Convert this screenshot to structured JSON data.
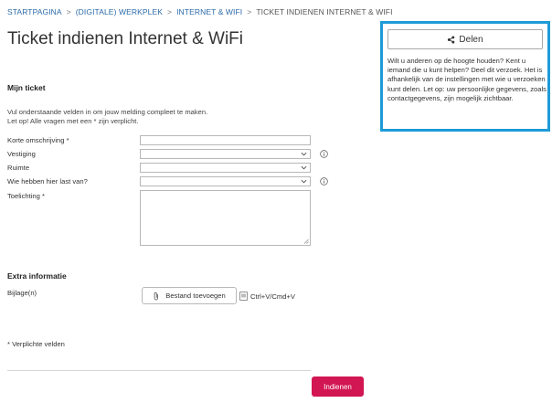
{
  "breadcrumb": {
    "items": [
      "STARTPAGINA",
      "(DIGITALE) WERKPLEK",
      "INTERNET & WIFI"
    ],
    "current": "TICKET INDIENEN INTERNET & WIFI",
    "separator": ">"
  },
  "page_title": "Ticket indienen Internet & WiFi",
  "my_ticket": {
    "heading": "Mijn ticket",
    "intro_line1": "Vul onderstaande velden in om jouw melding compleet te maken.",
    "intro_line2": "Let op! Alle vragen met een * zijn verplicht."
  },
  "form": {
    "short_description": {
      "label": "Korte omschrijving *",
      "value": ""
    },
    "location": {
      "label": "Vestiging",
      "value": ""
    },
    "room": {
      "label": "Ruimte",
      "value": ""
    },
    "affected": {
      "label": "Wie hebben hier last van?",
      "value": ""
    },
    "explanation": {
      "label": "Toelichting *",
      "value": ""
    }
  },
  "extra_info": {
    "heading": "Extra informatie",
    "attachment_label": "Bijlage(n)",
    "add_file_button": "Bestand toevoegen",
    "paste_hint": "Ctrl+V/Cmd+V"
  },
  "required_note": "* Verplichte velden",
  "submit_button": "Indienen",
  "share_panel": {
    "button_label": "Delen",
    "text": "Wilt u anderen op de hoogte houden? Kent u iemand die u kunt helpen? Deel dit verzoek. Het is afhankelijk van de instellingen met wie u verzoeken kunt delen. Let op: uw persoonlijke gegevens, zoals contactgegevens, zijn mogelijk zichtbaar."
  },
  "colors": {
    "accent_link": "#2a6aa8",
    "submit": "#d21553",
    "panel_border": "#1e9bd7"
  },
  "icons": [
    "share-icon",
    "info-icon",
    "paperclip-icon",
    "clipboard-icon",
    "chevron-down-icon"
  ]
}
